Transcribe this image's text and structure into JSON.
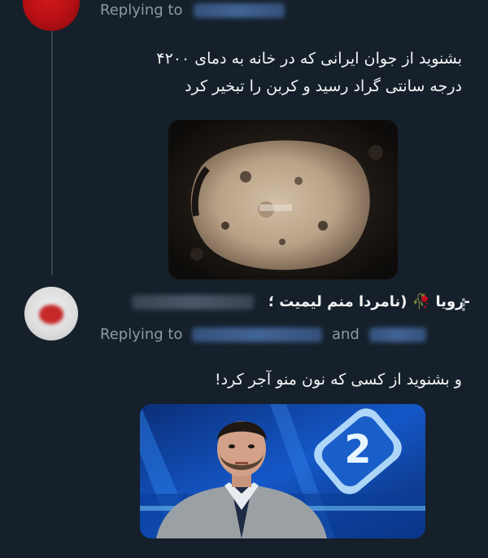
{
  "tweet1": {
    "replying_label": "Replying to",
    "text_line1": "بشنوید از جوان ایرانی که در خانه به دمای ۴۲۰۰",
    "text_line2": "درجه سانتی گراد رسید و کربن را تبخیر کرد"
  },
  "tweet2": {
    "display_name": "-رویا 🥀 (نامردا منم لیمیت ؛",
    "replying_label": "Replying to",
    "and_label": "and",
    "text": "و بشنوید از کسی که نون منو آجر کرد!"
  },
  "colors": {
    "background": "#15202b",
    "muted_text": "#8b98a5",
    "thread_line": "#38444d"
  },
  "icons": {
    "more": "more-vertical-icon"
  }
}
